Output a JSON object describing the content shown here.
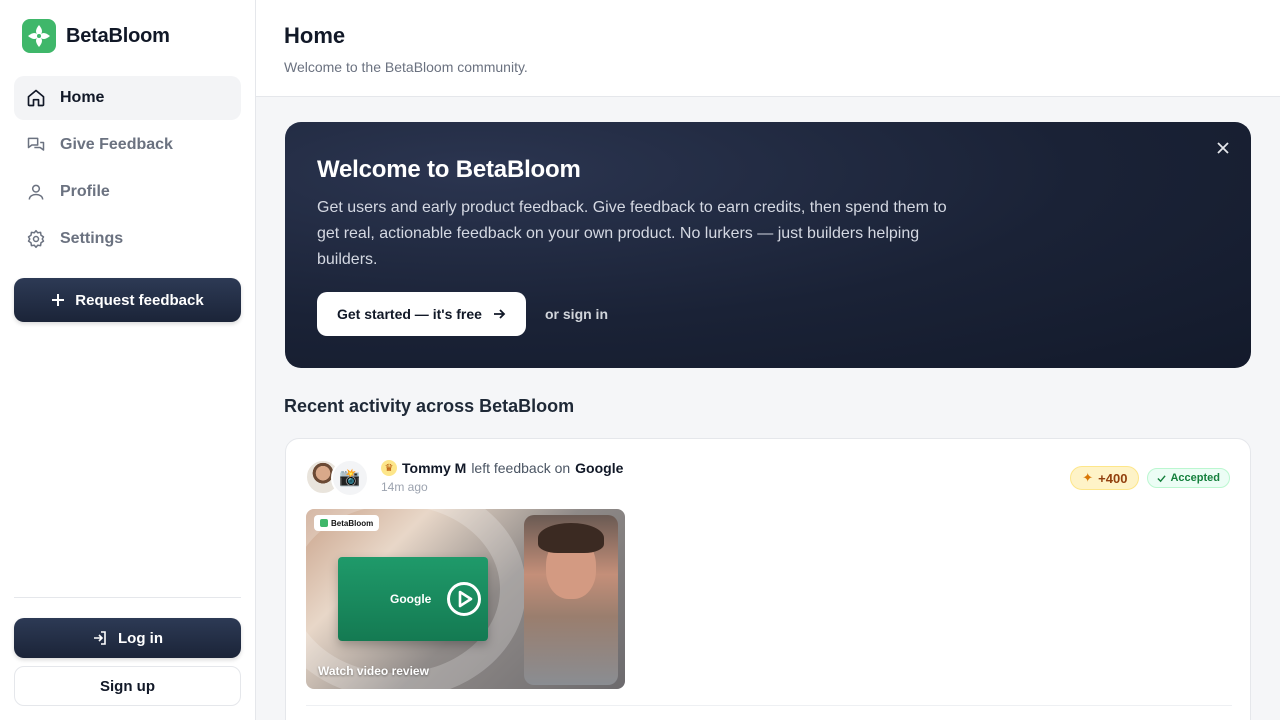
{
  "brand": {
    "name": "BetaBloom",
    "accent": "#3fb76a"
  },
  "sidebar": {
    "items": [
      {
        "label": "Home",
        "icon": "home-icon",
        "active": true
      },
      {
        "label": "Give Feedback",
        "icon": "chat-icon",
        "active": false
      },
      {
        "label": "Profile",
        "icon": "user-icon",
        "active": false
      },
      {
        "label": "Settings",
        "icon": "gear-icon",
        "active": false
      }
    ],
    "request_label": "Request feedback",
    "login_label": "Log in",
    "signup_label": "Sign up"
  },
  "header": {
    "title": "Home",
    "subtitle": "Welcome to the BetaBloom community."
  },
  "hero": {
    "title": "Welcome to BetaBloom",
    "description": "Get users and early product feedback. Give feedback to earn credits, then spend them to get real, actionable feedback on your own product. No lurkers — just builders helping builders.",
    "cta_label": "Get started — it's free",
    "signin_label": "or sign in"
  },
  "activity": {
    "section_title": "Recent activity across BetaBloom",
    "items": [
      {
        "user": "Tommy M",
        "action": "left feedback on",
        "product": "Google",
        "time": "14m ago",
        "credits": "+400",
        "status": "Accepted",
        "video": {
          "brand": "BetaBloom",
          "tile_label": "Google",
          "caption": "Watch video review"
        }
      }
    ]
  }
}
